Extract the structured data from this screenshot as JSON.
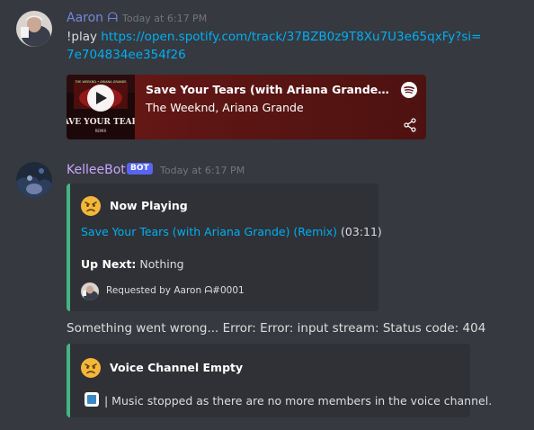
{
  "message1": {
    "username": "Aaron ᗩ",
    "username_color": "#7289da",
    "timestamp": "Today at 6:17 PM",
    "command": "!play",
    "link_text": "https://open.spotify.com/track/37BZB0z9T8Xu7U3e65qxFy?si=7e704834ee354f26"
  },
  "spotify_embed": {
    "title": "Save Your Tears (with Ariana Grande) (Remix)",
    "artist": "The Weeknd, Ariana Grande",
    "album_art_text": "SAVE YOUR TEARS",
    "album_art_subtext": "REMIX",
    "album_art_header": "THE WEEKND • ARIANA GRANDE"
  },
  "message2": {
    "username": "KelleeBot",
    "username_color": "#c9a5ff",
    "bot_tag": "BOT",
    "timestamp": "Today at 6:17 PM"
  },
  "now_playing_embed": {
    "title": "Now Playing",
    "song_link": "Save Your Tears (with Ariana Grande) (Remix)",
    "duration": "(03:11)",
    "up_next_label": "Up Next:",
    "up_next_value": "Nothing",
    "footer": "Requested by Aaron ᗩ#0001",
    "accent_color": "#43b581"
  },
  "error_message": "Something went wrong... Error: Error: input stream: Status code: 404",
  "voice_embed": {
    "title": "Voice Channel Empty",
    "text": "| Music stopped as there are no more members in the voice channel.",
    "accent_color": "#43b581"
  }
}
